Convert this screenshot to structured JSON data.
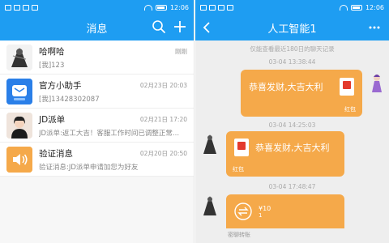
{
  "status": {
    "time": "12:06"
  },
  "left": {
    "title": "消息",
    "conversations": [
      {
        "name": "哈啊哈",
        "time": "刚刚",
        "preview": "[我]123"
      },
      {
        "name": "官方小助手",
        "time": "02月23日 20:03",
        "preview": "[我]13428302087"
      },
      {
        "name": "JD派单",
        "time": "02月21日 17:20",
        "preview": "JD派单:返工大吉！客服工作时间已调整正常..."
      },
      {
        "name": "验证消息",
        "time": "02月20日 20:50",
        "preview": "验证消息:JD派单申请加您为好友"
      }
    ]
  },
  "right": {
    "title": "人工智能1",
    "notice": "仅能查看最近180日的聊天记录",
    "messages": [
      {
        "time": "03-04 13:38:44",
        "text": "恭喜发财,大吉大利",
        "foot": "红包"
      },
      {
        "time": "03-04 14:25:03",
        "text": "恭喜发财,大吉大利",
        "foot": "红包"
      },
      {
        "time": "03-04 17:48:47",
        "amount": "¥10",
        "sub": "1",
        "foot": "密聊转账"
      }
    ]
  }
}
